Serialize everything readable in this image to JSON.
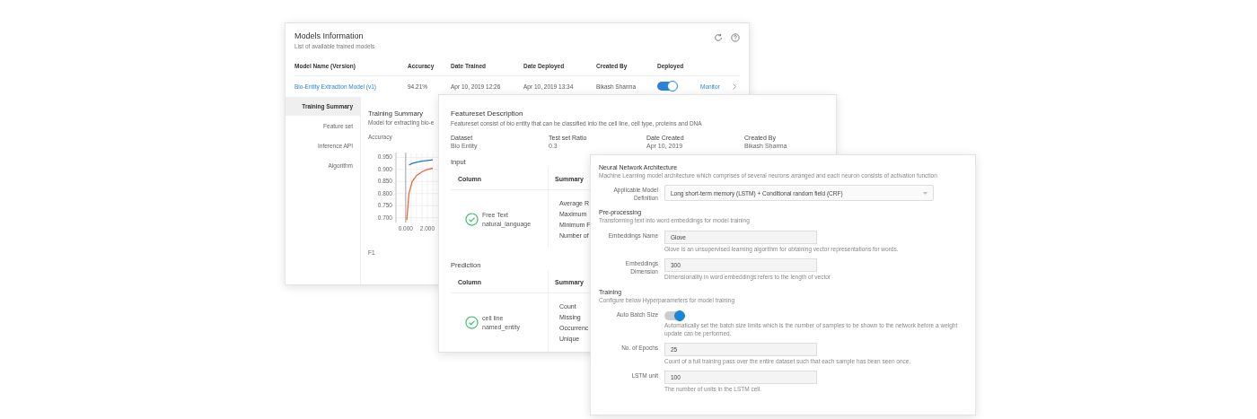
{
  "models_panel": {
    "title": "Models Information",
    "subtitle": "List of available trained models",
    "columns": [
      "Model Name (Version)",
      "Accuracy",
      "Date Trained",
      "Date Deployed",
      "Created By",
      "Deployed"
    ],
    "rows": [
      {
        "name": "Bio-Entity Extraction Model (v1)",
        "accuracy": "94.21%",
        "date_trained": "Apr 10, 2019 12:26",
        "date_deployed": "Apr 10, 2019 13:34",
        "created_by": "Bikash Sharma",
        "deployed": true,
        "action": "Monitor"
      }
    ],
    "side_tabs": [
      {
        "label": "Training Summary",
        "selected": true
      },
      {
        "label": "Feature set",
        "selected": false
      },
      {
        "label": "Inference API",
        "selected": false
      },
      {
        "label": "Algorithm",
        "selected": false
      }
    ],
    "summary": {
      "title": "Training Summary",
      "subtitle": "Model for extracting bio-e",
      "chart_data": {
        "type": "line",
        "title": "Accuracy",
        "x": [
          0.1,
          0.3,
          0.6,
          1.0,
          1.5,
          2.0,
          2.5
        ],
        "series": [
          {
            "color": "#2176c4",
            "values": [
              null,
              0.918,
              0.925,
              0.93,
              0.934,
              0.937,
              0.94
            ]
          },
          {
            "color": "#f2643a",
            "values": [
              0.69,
              0.8,
              0.85,
              0.875,
              0.89,
              0.9,
              0.905
            ]
          }
        ],
        "xlim": [
          -0.9,
          3.0
        ],
        "grid": true,
        "ylim": [
          0.68,
          0.97
        ],
        "yticks": [
          {
            "value": 0.95,
            "label": "0.950"
          },
          {
            "value": 0.9,
            "label": "0.900"
          },
          {
            "value": 0.85,
            "label": "0.850"
          },
          {
            "value": 0.8,
            "label": "0.800"
          },
          {
            "value": 0.75,
            "label": "0.750"
          },
          {
            "value": 0.7,
            "label": "0.700"
          }
        ],
        "xticks": [
          {
            "value": 0,
            "label": "0.000"
          },
          {
            "value": 2,
            "label": "2.000"
          }
        ]
      },
      "second_chart_title": "F1"
    }
  },
  "featureset_panel": {
    "title": "Featureset Description",
    "description": "Featureset consist of bio entity that can be classified into the cell line, cell type, proteins and DNA",
    "fields": [
      {
        "label": "Dataset",
        "value": "Bio Entity"
      },
      {
        "label": "Test set Ratio",
        "value": "0.3"
      },
      {
        "label": "Date Created",
        "value": "Apr 10, 2019"
      },
      {
        "label": "Created By",
        "value": "Bikash Sharma"
      }
    ],
    "sections": [
      {
        "title": "Input",
        "columns": [
          "Column",
          "Summary"
        ],
        "name": "Free Text",
        "type": "natural_language",
        "valid": true,
        "summary_items": [
          "Average R",
          "Maximum",
          "Minimum F",
          "Number of"
        ]
      },
      {
        "title": "Prediction",
        "columns": [
          "Column",
          "Summary"
        ],
        "name": "cell line",
        "type": "named_entity",
        "valid": true,
        "summary_items": [
          "Count",
          "Missing",
          "Occurrenc",
          "Unique"
        ]
      }
    ]
  },
  "architecture_panel": {
    "sections": [
      {
        "title": "Neural Network Architecture",
        "description": "Machine Learning model architecture which comprises of several neurons arranged and each neuron consists of activation function",
        "fields": [
          {
            "kind": "select",
            "label": "Applicable Model Definition",
            "value": "Long short-term memory (LSTM) + Conditional random field (CRF)"
          }
        ]
      },
      {
        "title": "Pre-processing",
        "description": "Transforming text into word embeddings for model training",
        "fields": [
          {
            "kind": "input",
            "label": "Embeddings Name",
            "value": "Glove",
            "help": "Glove is an unsupervised learning algorithm for obtaining vector representations for words."
          },
          {
            "kind": "input",
            "label": "Embeddings Dimension",
            "value": "300",
            "help": "Dimensionality in word embeddings refers to the length of vector"
          }
        ]
      },
      {
        "title": "Training",
        "description": "Configure below Hyperparameters for model training",
        "fields": [
          {
            "kind": "toggle",
            "label": "Auto Batch Size",
            "on": true,
            "help": "Automatically set the batch size limits which is the number of samples to be shown to the network before a weight update can be performed."
          },
          {
            "kind": "input",
            "label": "No. of Epochs",
            "value": "25",
            "help": "Count of a full training pass over the entire dataset such that each sample has been seen once."
          },
          {
            "kind": "input",
            "label": "LSTM unit",
            "value": "100",
            "help": "The number of units in the LSTM cell."
          }
        ]
      }
    ]
  }
}
